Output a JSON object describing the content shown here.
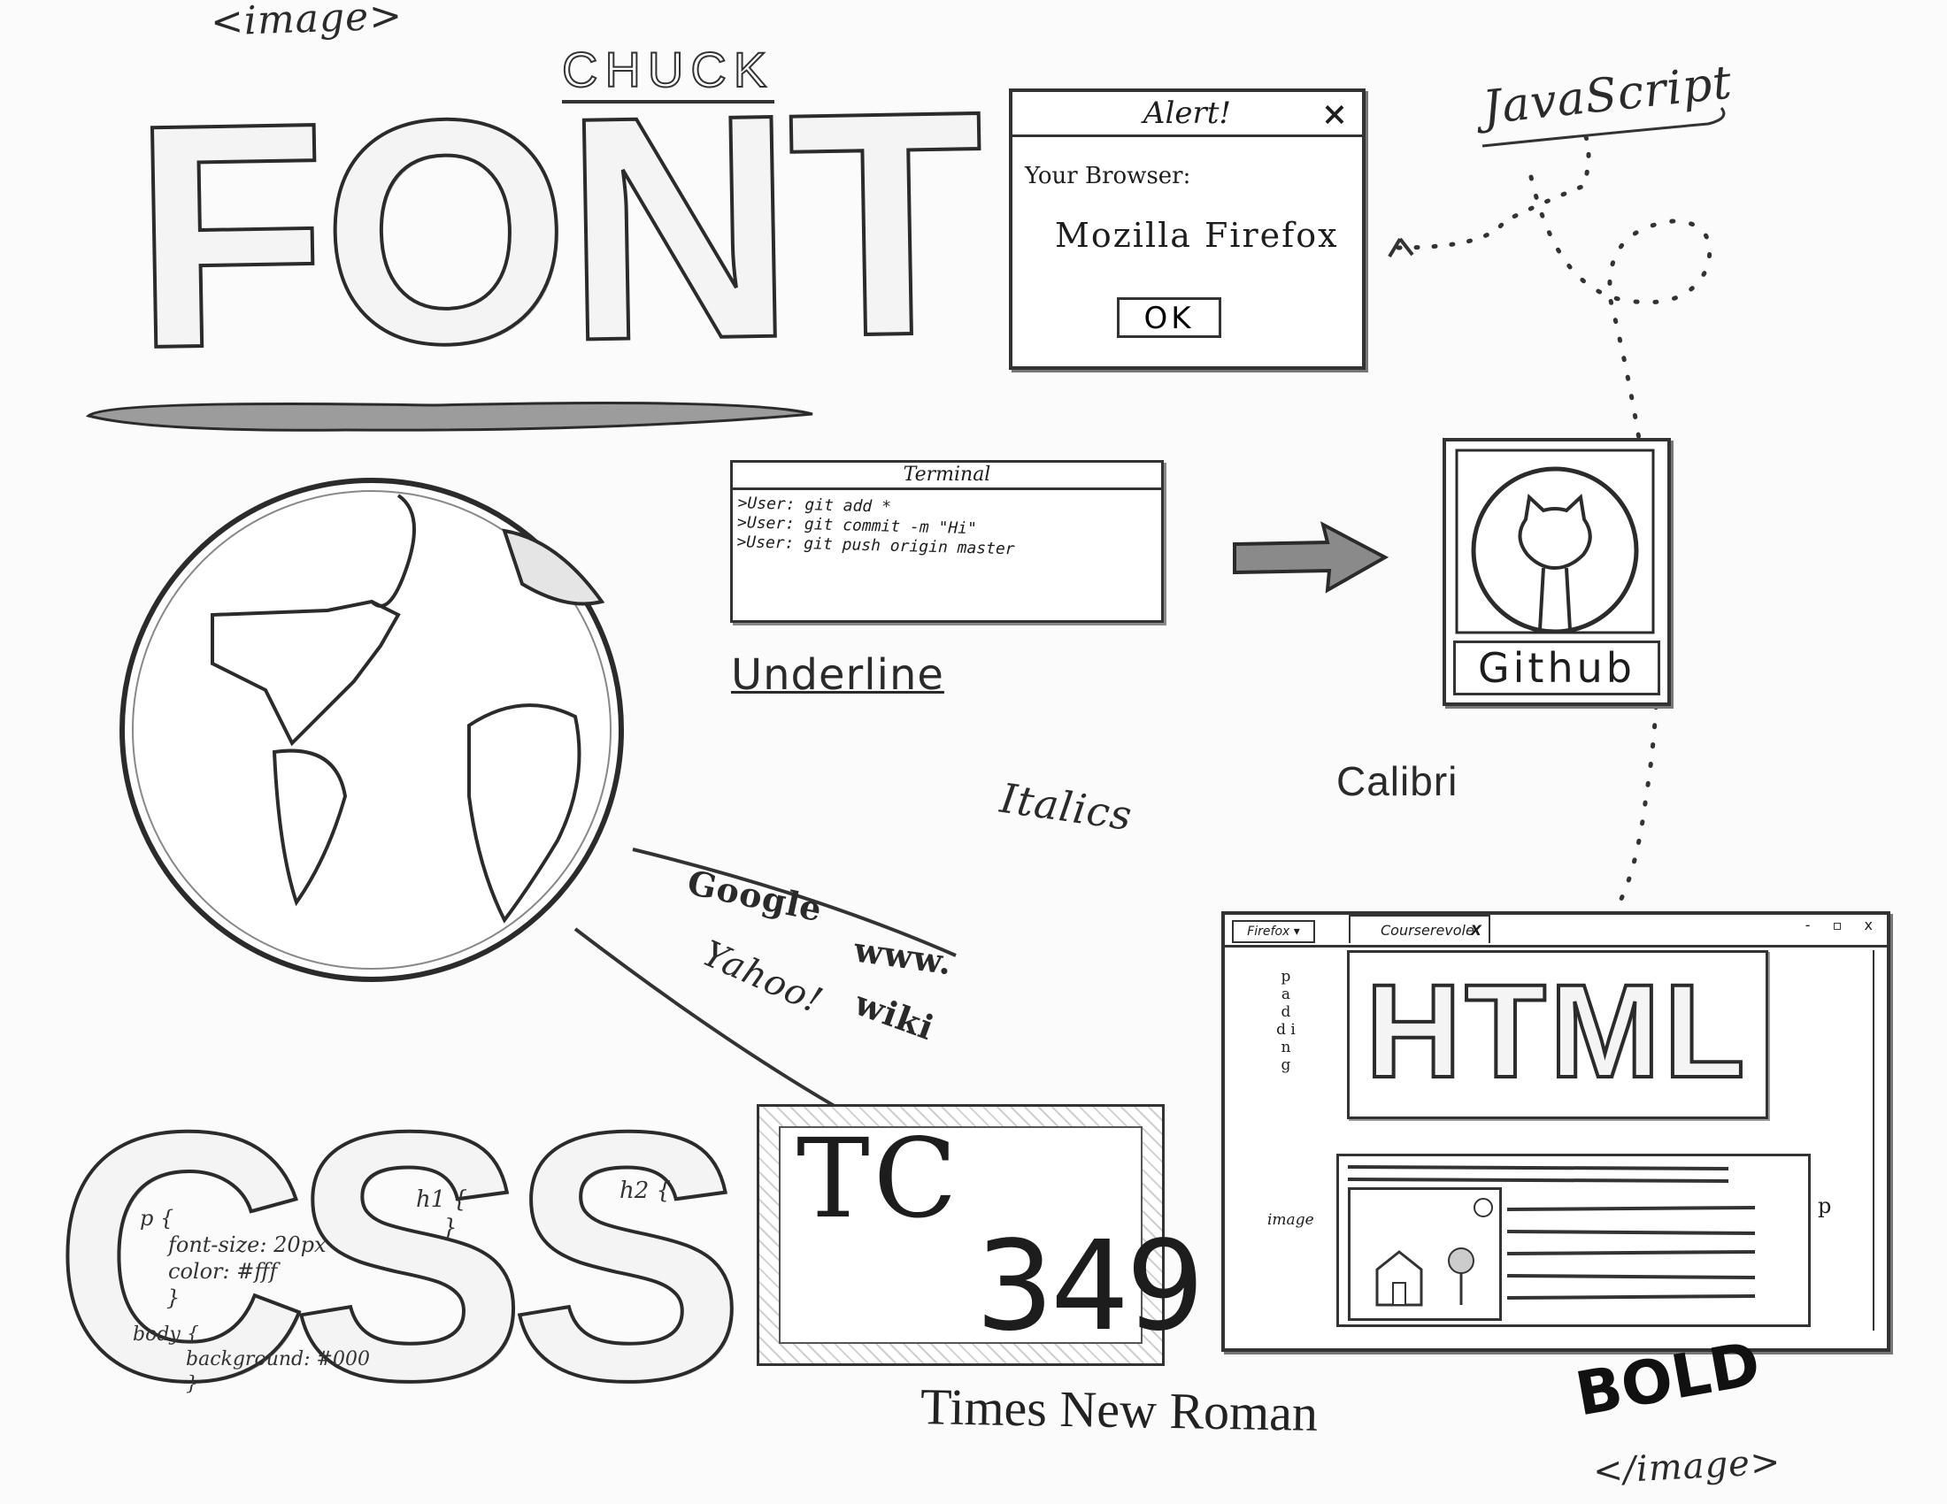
{
  "open_tag": "<image>",
  "close_tag": "</image>",
  "chuck": "CHUCK",
  "font_word": "FONT",
  "javascript_label": "JavaScript",
  "alert": {
    "title": "Alert!",
    "close": "×",
    "label": "Your Browser:",
    "value": "Mozilla Firefox",
    "ok": "OK"
  },
  "terminal": {
    "title": "Terminal",
    "lines": [
      ">User: git add *",
      ">User: git commit -m \"Hi\"",
      ">User: git push origin master"
    ]
  },
  "github": "Github",
  "underline": "Underline",
  "italics": "Italics",
  "calibri": "Calibri",
  "search_terms": {
    "google": "Google",
    "yahoo": "Yahoo!",
    "www": "www.",
    "wiki": "wiki"
  },
  "css": {
    "word": "CSS",
    "code_p": [
      "p {",
      "font-size: 20px",
      "color: #fff",
      "}"
    ],
    "code_body": [
      "body {",
      "background: #000",
      "}"
    ],
    "h1": [
      "h1 {",
      "}"
    ],
    "h2": [
      "h2 {",
      "}"
    ]
  },
  "tc": {
    "line1": "TC",
    "line2": "349"
  },
  "times_new_roman": "Times New Roman",
  "bold": "BOLD",
  "browser": {
    "firefox_menu": "Firefox ▾",
    "tab_title": "Courserevole",
    "tab_close": "X",
    "controls": "- ▫ x",
    "heading": "HTML",
    "padding_label": "p a d d i n g",
    "image_label": "image",
    "p_label": "p"
  }
}
